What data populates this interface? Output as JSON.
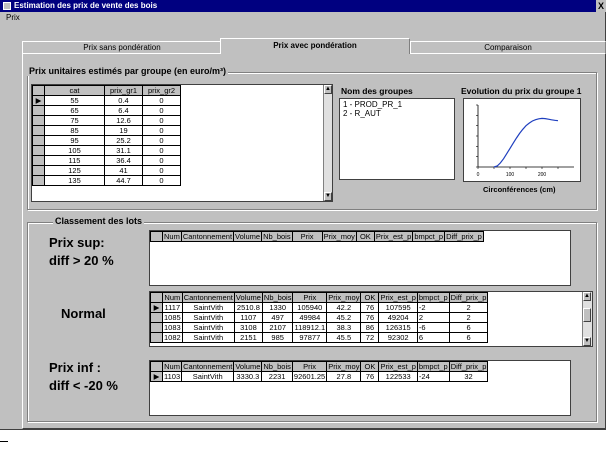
{
  "window": {
    "title": "Estimation des prix de vente des bois",
    "close_label": "X"
  },
  "menu": {
    "item": "Prix"
  },
  "tabs": [
    {
      "label": "Prix sans pondération"
    },
    {
      "label": "Prix avec pondération"
    },
    {
      "label": "Comparaison"
    }
  ],
  "prix_unitaires": {
    "title": "Prix unitaires estimés par groupe (en euro/m³)",
    "columns": [
      "cat",
      "prix_gr1",
      "prix_gr2"
    ],
    "rows": [
      [
        "55",
        "0.4",
        "0"
      ],
      [
        "65",
        "6.4",
        "0"
      ],
      [
        "75",
        "12.6",
        "0"
      ],
      [
        "85",
        "19",
        "0"
      ],
      [
        "95",
        "25.2",
        "0"
      ],
      [
        "105",
        "31.1",
        "0"
      ],
      [
        "115",
        "36.4",
        "0"
      ],
      [
        "125",
        "41",
        "0"
      ],
      [
        "135",
        "44.7",
        "0"
      ]
    ]
  },
  "groupes": {
    "title": "Nom des groupes",
    "items": [
      "1 - PROD_PR_1",
      "2 - R_AUT"
    ]
  },
  "evolution": {
    "title": "Evolution du prix du groupe 1",
    "xlabel": "Circonférences (cm)"
  },
  "chart_data": {
    "type": "line",
    "title": "Evolution du prix du groupe 1",
    "xlabel": "Circonférences (cm)",
    "ylabel": "",
    "x": [
      50,
      60,
      70,
      80,
      90,
      100,
      110,
      120,
      130,
      140,
      150,
      160,
      170,
      180,
      190,
      200,
      210,
      220,
      230,
      240,
      250
    ],
    "y": [
      0,
      1,
      4,
      8,
      13,
      18,
      23,
      28,
      32.5,
      36.5,
      40,
      42.5,
      44.5,
      45.8,
      46.6,
      47,
      46.8,
      46.3,
      45.7,
      45.2,
      44.8
    ],
    "xlim": [
      0,
      300
    ],
    "ylim": [
      0,
      60
    ],
    "xticks": [
      "0",
      "50",
      "100",
      "150",
      "200",
      "250"
    ],
    "yticks": [
      "",
      "",
      "",
      "",
      "",
      ""
    ]
  },
  "classement": {
    "title": "Classement des lots",
    "columns": [
      "Num",
      "Cantonnement",
      "Volume",
      "Nb_bois",
      "Prix",
      "Prix_moy",
      "OK",
      "Prix_est_p",
      "bmpct_p",
      "Diff_prix_p"
    ],
    "sup": {
      "label_line1": "Prix sup:",
      "label_line2": "diff > 20 %",
      "rows": []
    },
    "normal": {
      "label": "Normal",
      "rows": [
        [
          "1117",
          "SaintVith",
          "2510.8",
          "1330",
          "105940",
          "42.2",
          "76",
          "107595",
          "-2",
          "2"
        ],
        [
          "1085",
          "SaintVith",
          "1107",
          "497",
          "49984",
          "45.2",
          "76",
          "49204",
          "2",
          "2"
        ],
        [
          "1083",
          "SaintVith",
          "3108",
          "2107",
          "118912.1",
          "38.3",
          "86",
          "126315",
          "-6",
          "6"
        ],
        [
          "1082",
          "SaintVith",
          "2151",
          "985",
          "97877",
          "45.5",
          "72",
          "92302",
          "6",
          "6"
        ]
      ]
    },
    "inf": {
      "label_line1": "Prix inf :",
      "label_line2": "diff < -20 %",
      "rows": [
        [
          "1103",
          "SaintVith",
          "3330.3",
          "2231",
          "92601.25",
          "27.8",
          "76",
          "122533",
          "-24",
          "32"
        ]
      ]
    }
  }
}
